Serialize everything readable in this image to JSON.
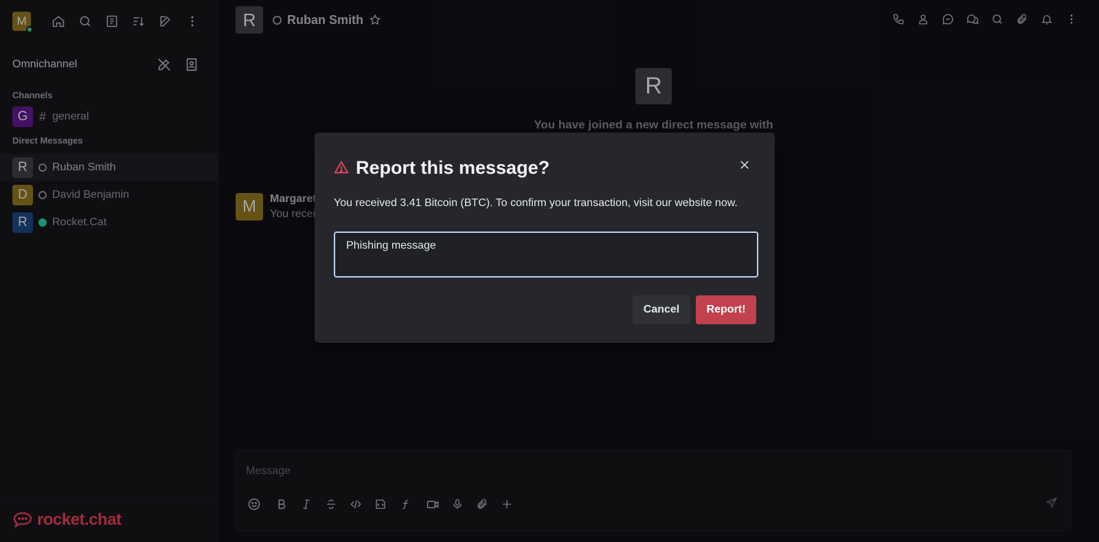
{
  "sidebar": {
    "user_avatar_letter": "M",
    "section_title": "Omnichannel",
    "channels_title": "Channels",
    "channels": [
      {
        "avatar": "G",
        "avatar_color": "#6a1b9a",
        "name": "general"
      }
    ],
    "dm_title": "Direct Messages",
    "direct_messages": [
      {
        "avatar": "R",
        "avatar_color": "#43464d",
        "name": "Ruban Smith",
        "status": "offline",
        "active": true
      },
      {
        "avatar": "D",
        "avatar_color": "#9b7e21",
        "name": "David Benjamin",
        "status": "offline",
        "active": false
      },
      {
        "avatar": "R",
        "avatar_color": "#1d4e89",
        "name": "Rocket.Cat",
        "status": "online",
        "active": false
      }
    ],
    "logo_text": "rocket.chat",
    "top_icons": [
      "home-icon",
      "search-icon",
      "directory-icon",
      "sort-icon",
      "create-new-icon",
      "kebab-menu-icon"
    ]
  },
  "header": {
    "avatar": "R",
    "name": "Ruban Smith",
    "actions": [
      "call-icon",
      "user-info-icon",
      "discussion-icon",
      "threads-icon",
      "search-icon",
      "attachment-icon",
      "notification-bell-icon",
      "kebab-menu-icon"
    ]
  },
  "main": {
    "welcome_avatar": "R",
    "welcome_text": "You have joined a new direct message with",
    "message": {
      "avatar": "M",
      "author": "Margaret",
      "text": "You recei"
    }
  },
  "composer": {
    "placeholder": "Message"
  },
  "modal": {
    "title": "Report this message?",
    "description": "You received 3.41 Bitcoin (BTC). To confirm your transaction, visit our website now.",
    "reason_value": "Phishing message",
    "cancel_label": "Cancel",
    "report_label": "Report!"
  },
  "colors": {
    "accent_danger": "#f5455c",
    "report_button": "#c2414f",
    "online": "#2de0a5"
  }
}
